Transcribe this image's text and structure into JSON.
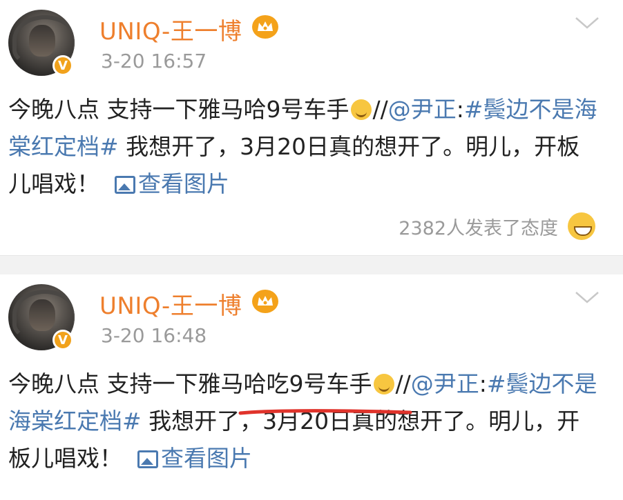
{
  "posts": [
    {
      "username": "UNIQ-王一博",
      "time": "3-20 16:57",
      "text_lead": "今晚八点 支持一下雅马哈9号车手",
      "repost_sep": "//",
      "mention": "@尹正",
      "colon": ":",
      "hashtag": "#鬓边不是海棠红定档#",
      "text_rest": " 我想开了，3月20日真的想开了。明儿，开板儿唱戏！",
      "view_images": "查看图片",
      "reactions": "2382人发表了态度"
    },
    {
      "username": "UNIQ-王一博",
      "time": "3-20 16:48",
      "text_lead": "今晚八点 支持一下雅马哈吃9号车手",
      "repost_sep": "//",
      "mention": "@尹正",
      "colon": ":",
      "hashtag": "#鬓边不是海棠红定档#",
      "text_rest": " 我想开了，3月20日真的想开了。明儿，开板儿唱戏！",
      "view_images": "查看图片"
    }
  ],
  "icons": {
    "verified": "verified-v-badge-icon",
    "member": "crown-icon",
    "menu": "chevron-down-icon",
    "emoji": "smile-emoji-icon",
    "image": "image-icon",
    "reaction": "laugh-emoji-icon"
  },
  "colors": {
    "username": "#ee7f2d",
    "link": "#4a79b0",
    "annotation": "#e0332b"
  }
}
